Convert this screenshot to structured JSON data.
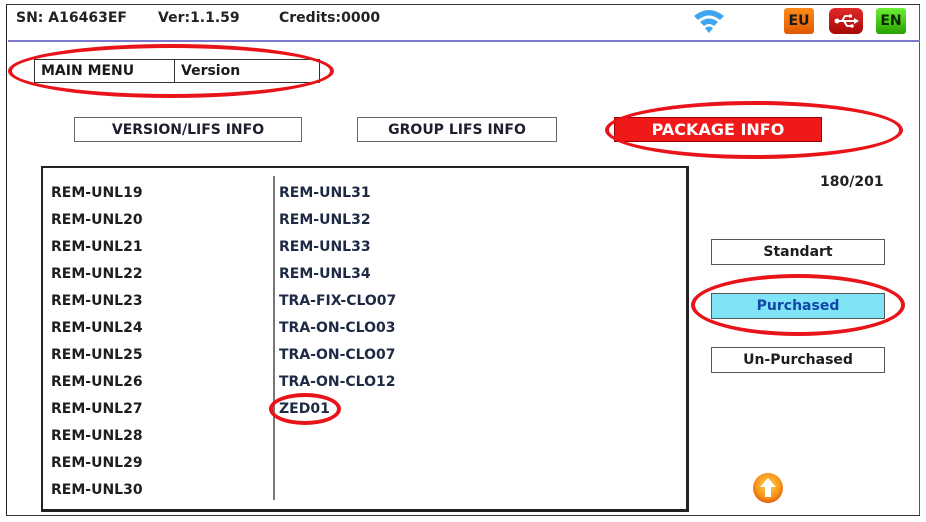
{
  "status_bar": {
    "serial": "SN: A16463EF",
    "version": "Ver:1.1.59",
    "credits": "Credits:0000",
    "icons": {
      "wifi": "wifi-icon",
      "region": "EU",
      "usb": "usb-icon",
      "language": "EN"
    }
  },
  "breadcrumb": {
    "root": "MAIN MENU",
    "current": "Version"
  },
  "tabs": [
    {
      "label": "VERSION/LIFS INFO",
      "active": false
    },
    {
      "label": "GROUP LIFS INFO",
      "active": false
    },
    {
      "label": "PACKAGE INFO",
      "active": true
    }
  ],
  "package_list": {
    "column1": [
      "REM-UNL19",
      "REM-UNL20",
      "REM-UNL21",
      "REM-UNL22",
      "REM-UNL23",
      "REM-UNL24",
      "REM-UNL25",
      "REM-UNL26",
      "REM-UNL27",
      "REM-UNL28",
      "REM-UNL29",
      "REM-UNL30"
    ],
    "column2": [
      "REM-UNL31",
      "REM-UNL32",
      "REM-UNL33",
      "REM-UNL34",
      "TRA-FIX-CLO07",
      "TRA-ON-CLO03",
      "TRA-ON-CLO07",
      "TRA-ON-CLO12",
      "ZED01"
    ]
  },
  "counter": "180/201",
  "filters": [
    {
      "label": "Standart",
      "active": false
    },
    {
      "label": "Purchased",
      "active": true
    },
    {
      "label": "Un-Purchased",
      "active": false
    }
  ],
  "scroll_up": "arrow-up-icon",
  "colors": {
    "accent_active_tab": "#f01818",
    "active_filter": "#7fe4f6",
    "annotation": "#e8141a",
    "header_line": "#7b78d0"
  }
}
